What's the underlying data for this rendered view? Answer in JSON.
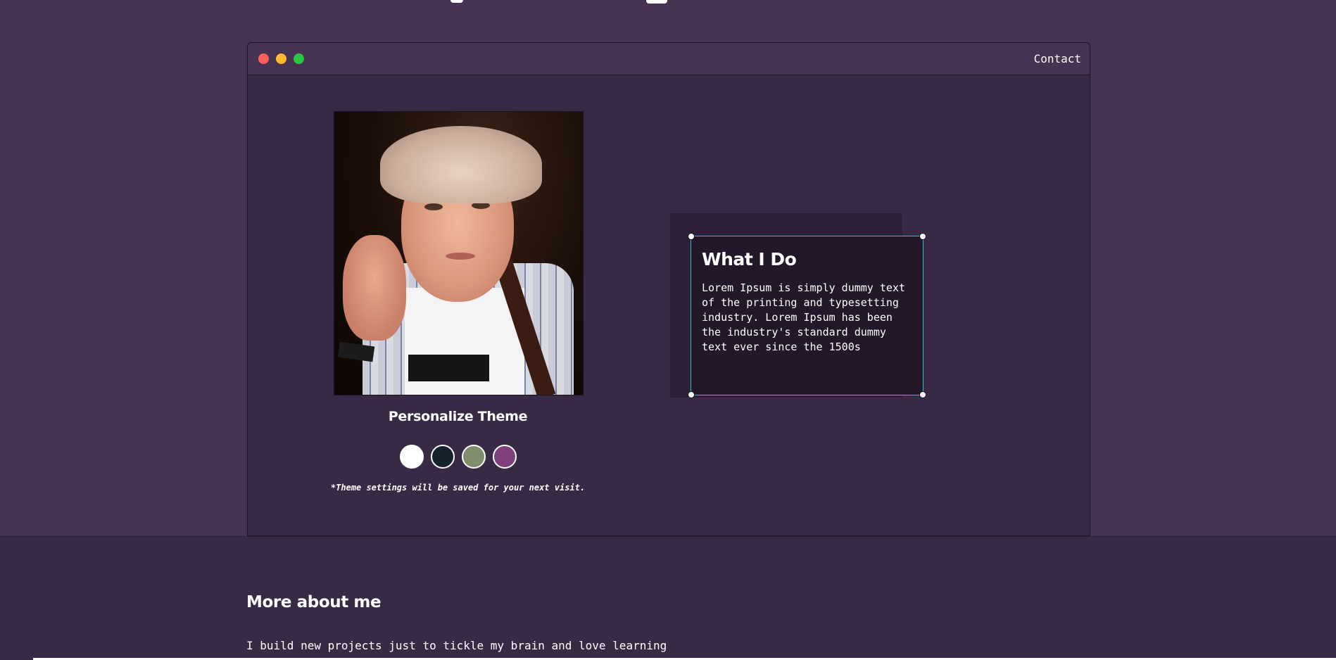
{
  "window": {
    "contact_label": "Contact"
  },
  "profile": {
    "theme_title": "Personalize Theme",
    "theme_note": "*Theme settings will be saved for your next visit.",
    "swatches": [
      {
        "name": "white",
        "color": "#ffffff"
      },
      {
        "name": "dark-navy",
        "color": "#15232e"
      },
      {
        "name": "sage-green",
        "color": "#7f8d6c"
      },
      {
        "name": "plum",
        "color": "#7e3f7a"
      }
    ]
  },
  "card": {
    "title": "What I Do",
    "body": "Lorem Ipsum is simply dummy text of the printing and typesetting industry. Lorem Ipsum has been the industry's standard dummy text ever since the 1500s"
  },
  "about": {
    "title": "More about me",
    "body": "I build new projects just to tickle my brain and love learning"
  },
  "colors": {
    "page_bg": "#463352",
    "window_bg": "#382a44",
    "card_bg": "#231829",
    "selection_accent": "#2ec4c4"
  }
}
